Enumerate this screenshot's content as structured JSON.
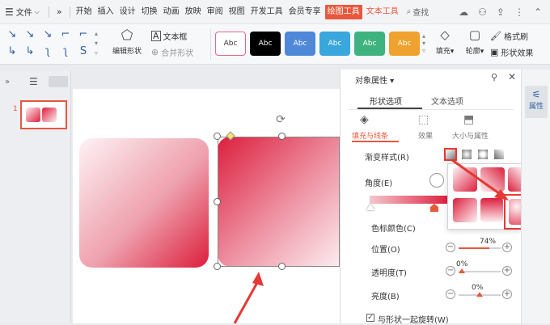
{
  "menubar": {
    "file_label": "文件",
    "tabs": [
      "开始",
      "插入",
      "设计",
      "切换",
      "动画",
      "放映",
      "审阅",
      "视图",
      "开发工具",
      "会员专享"
    ],
    "draw_tools": "绘图工具",
    "text_tools": "文本工具",
    "search": "查找"
  },
  "ribbon": {
    "edit_shape": "编辑形状",
    "text_box": "文本框",
    "merge_shape": "合并形状",
    "style_label": "Abc",
    "fill": "填充",
    "outline": "轮廓",
    "format_brush": "格式刷",
    "shape_effect": "形状效果"
  },
  "thumbs": {
    "slide_number": "1"
  },
  "panel": {
    "title": "对象属性",
    "tab_shape": "形状选项",
    "tab_text": "文本选项",
    "sub_fill": "填充与线条",
    "sub_effect": "效果",
    "sub_size": "大小与属性",
    "gradient_style": "渐变样式(R)",
    "angle": "角度(E)",
    "stop_color": "色标颜色(C)",
    "position": "位置(O)",
    "position_value": "74%",
    "transparency": "透明度(T)",
    "transparency_value": "0%",
    "brightness": "亮度(B)",
    "brightness_value": "0%",
    "rotate_with_shape": "与形状一起旋转(W)"
  },
  "vstrip": {
    "label": "属性"
  },
  "colors": {
    "accent_red": "#e8583d",
    "shape_red": "#dc1e3c",
    "brand_blue": "#2f5fa7"
  }
}
